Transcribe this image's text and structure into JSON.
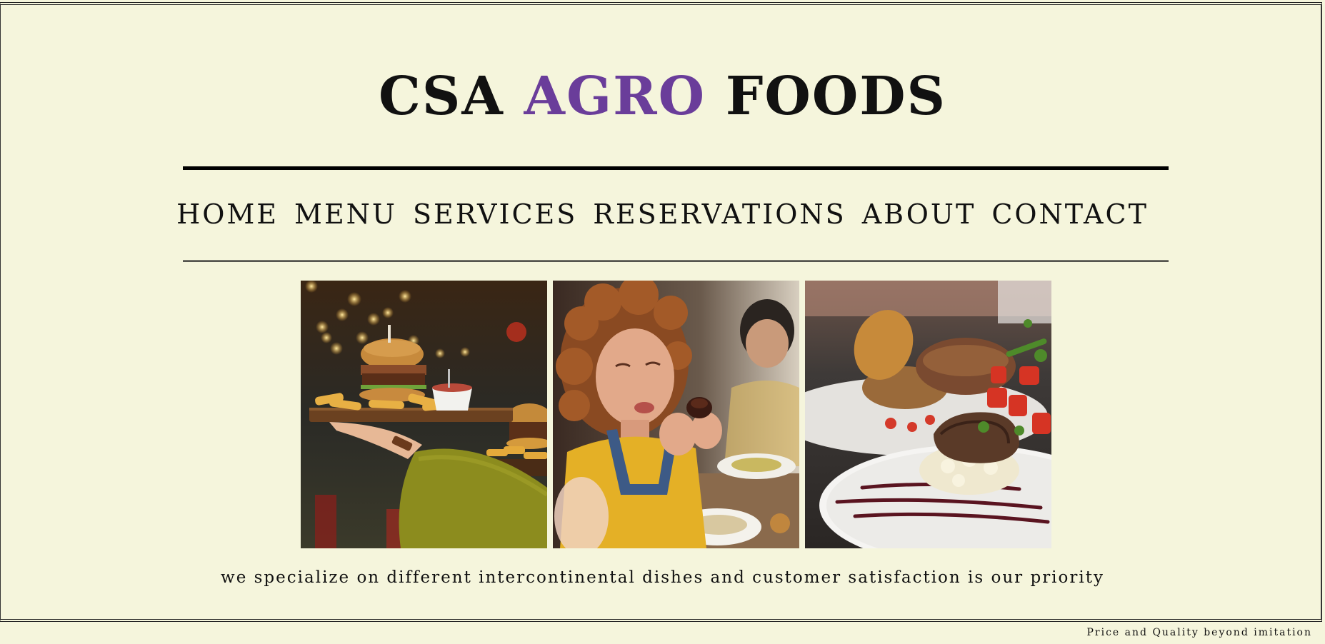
{
  "header": {
    "title_part1": "CSA",
    "title_accent": "AGRO",
    "title_part2": "FOODS",
    "accent_color": "#6a3d9a"
  },
  "nav": {
    "items": [
      "HOME",
      "MENU",
      "SERVICES",
      "RESERVATIONS",
      "ABOUT",
      "CONTACT"
    ]
  },
  "gallery": {
    "images": [
      {
        "subject": "burger-and-fries-tray-photo"
      },
      {
        "subject": "woman-enjoying-dessert-photo"
      },
      {
        "subject": "plated-steak-dish-photo"
      }
    ]
  },
  "tagline": "we specialize on different intercontinental dishes and customer satisfaction is our priority",
  "footer": {
    "note": "Price and Quality beyond imitation"
  },
  "colors": {
    "background": "#f5f5dc",
    "text": "#111111"
  }
}
